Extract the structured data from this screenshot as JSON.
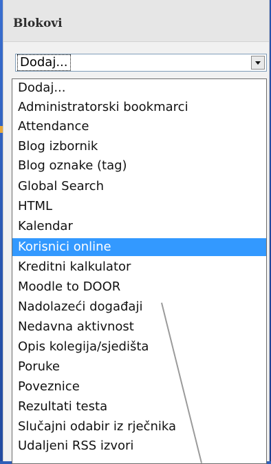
{
  "panel": {
    "title": "Blokovi"
  },
  "select": {
    "value": "Dodaj..."
  },
  "dropdown": {
    "selected_index": 9,
    "options": [
      "Dodaj...",
      "Administratorski bookmarci",
      "Attendance",
      "Blog izbornik",
      "Blog oznake (tag)",
      "Global Search",
      "HTML",
      "Kalendar",
      "Korisnici online",
      "Kreditni kalkulator",
      "Moodle to DOOR",
      "Nadolazeći događaji",
      "Nedavna aktivnost",
      "Opis kolegija/sjedišta",
      "Poruke",
      "Poveznice",
      "Rezultati testa",
      "Slučajni odabir iz rječnika",
      "Udaljeni RSS izvori"
    ]
  },
  "colors": {
    "selected_bg": "#3399ff",
    "background": "#2f5fb8"
  },
  "icons": {
    "select_arrow": "chevron-down-icon"
  }
}
